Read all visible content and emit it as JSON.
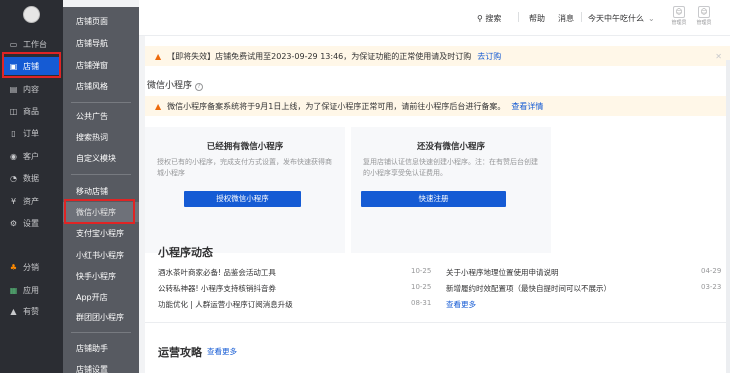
{
  "nav1": {
    "items": [
      {
        "label": "工作台",
        "icon": "monitor-icon"
      },
      {
        "label": "店铺",
        "icon": "store-icon"
      },
      {
        "label": "内容",
        "icon": "content-icon"
      },
      {
        "label": "商品",
        "icon": "goods-icon"
      },
      {
        "label": "订单",
        "icon": "order-icon"
      },
      {
        "label": "客户",
        "icon": "customer-icon"
      },
      {
        "label": "数据",
        "icon": "data-icon"
      },
      {
        "label": "资产",
        "icon": "asset-icon"
      },
      {
        "label": "设置",
        "icon": "settings-icon"
      },
      {
        "label": "分销",
        "icon": "distribution-icon"
      },
      {
        "label": "应用",
        "icon": "apps-icon"
      },
      {
        "label": "有赞",
        "icon": "youzan-icon"
      }
    ]
  },
  "nav2": {
    "items": [
      "店铺页面",
      "店铺导航",
      "店铺弹窗",
      "店铺风格",
      "公共广告",
      "搜索热词",
      "自定义模块",
      "移动店铺",
      "微信小程序",
      "支付宝小程序",
      "小红书小程序",
      "快手小程序",
      "App开店",
      "群团团小程序",
      "店铺助手",
      "店铺设置"
    ]
  },
  "header": {
    "search": "搜索",
    "help": "帮助",
    "messages": "消息",
    "greeting": "今天中午吃什么",
    "icon1_label": "管理员",
    "icon2_label": "管理员"
  },
  "notice_top": {
    "text": "【即将失效】店铺免费试用至2023-09-29 13:46，为保证功能的正常使用请及时订购",
    "link": "去订购"
  },
  "section": {
    "title": "微信小程序"
  },
  "notice_filing": {
    "text": "微信小程序备案系统将于9月1日上线，为了保证小程序正常可用，请前往小程序后台进行备案。",
    "link": "查看详情"
  },
  "cards": [
    {
      "title": "已经拥有微信小程序",
      "desc": "授权已有的小程序，完成支付方式设置，发布快速获得商城小程序",
      "button": "授权微信小程序"
    },
    {
      "title": "还没有微信小程序",
      "desc": "复用店铺认证信息快速创建小程序。注：在有赞后台创建的小程序享受免认证费用。",
      "button": "快速注册"
    }
  ],
  "dynamics": {
    "title": "小程序动态",
    "left": [
      {
        "text": "酒水茶叶商家必备! 品鉴会活动工具",
        "date": "10-25"
      },
      {
        "text": "公转私神器! 小程序支持核销抖音券",
        "date": "10-25"
      },
      {
        "text": "功能优化 | 人群运营小程序订阅消息升级",
        "date": "08-31"
      }
    ],
    "right": [
      {
        "text": "关于小程序地理位置使用申请说明",
        "date": "04-29"
      },
      {
        "text": "新增履约时效配置项（最快自提时间可以不展示）",
        "date": "03-23"
      }
    ],
    "more": "查看更多"
  },
  "strategy": {
    "title": "运营攻略",
    "more": "查看更多"
  }
}
